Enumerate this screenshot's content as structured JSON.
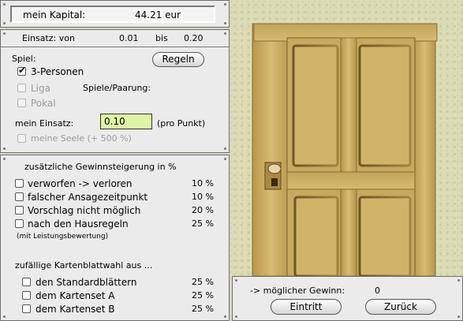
{
  "capital": {
    "label": "mein Kapital:",
    "value": "44.21 eur"
  },
  "stake_range": {
    "label": "Einsatz: von",
    "min": "0.01",
    "sep": "bis",
    "max": "0.20"
  },
  "game": {
    "label": "Spiel:",
    "rules_button": "Regeln",
    "three_person": "3-Personen",
    "league": "Liga",
    "games_per_pairing": "Spiele/Paarung:",
    "cup": "Pokal",
    "my_stake_label": "mein Einsatz:",
    "my_stake_value": "0.10",
    "per_point": "(pro Punkt)",
    "my_soul": "meine Seele (+ 500 %)"
  },
  "bonus": {
    "title": "zusätzliche Gewinnsteigerung in %",
    "items": [
      {
        "label": "verworfen -> verloren",
        "pct": "10 %"
      },
      {
        "label": "falscher Ansagezeitpunkt",
        "pct": "10 %"
      },
      {
        "label": "Vorschlag nicht möglich",
        "pct": "20 %"
      },
      {
        "label": "nach den Hausregeln",
        "pct": "25 %"
      }
    ],
    "note": "(mit Leistungsbewertung)"
  },
  "cardset": {
    "title": "zufällige Kartenblattwahl aus ...",
    "items": [
      {
        "label": "den Standardblättern",
        "pct": "25 %"
      },
      {
        "label": "dem Kartenset A",
        "pct": "25 %"
      },
      {
        "label": "dem Kartenset B",
        "pct": "25 %"
      }
    ]
  },
  "footer": {
    "possible_win_label": "-> möglicher Gewinn:",
    "possible_win_value": "0",
    "enter_button": "Eintritt",
    "back_button": "Zurück"
  },
  "colors": {
    "stake_field_bg": "#ddf5a6",
    "door_wood": "#c8a85a"
  },
  "icons": [
    "checkbox-icon",
    "door-image",
    "door-handle-icon"
  ]
}
